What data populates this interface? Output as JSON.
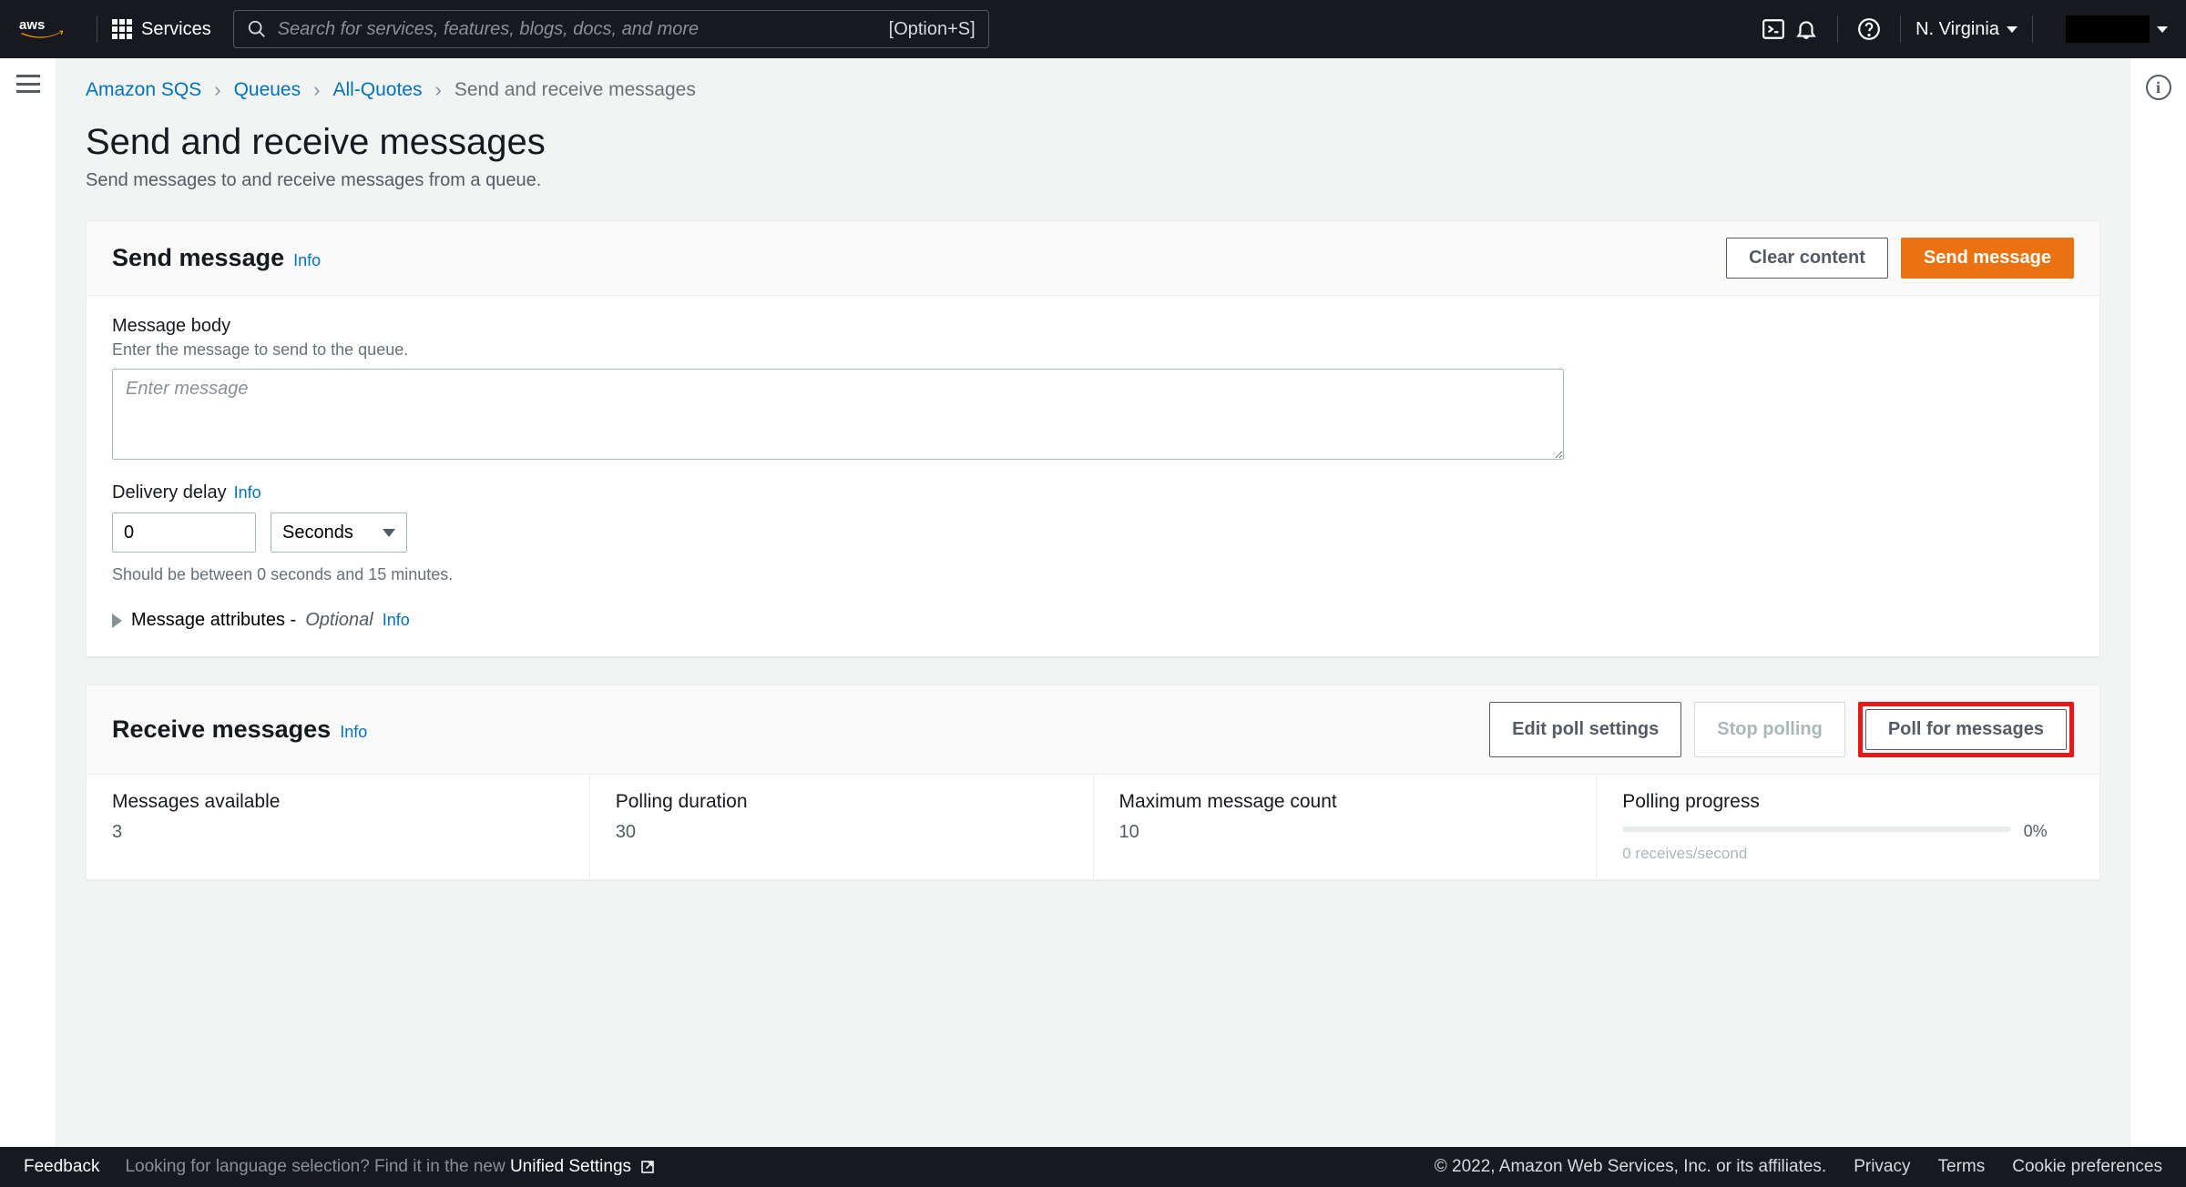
{
  "topnav": {
    "services_label": "Services",
    "search_placeholder": "Search for services, features, blogs, docs, and more",
    "search_hint": "[Option+S]",
    "region": "N. Virginia"
  },
  "breadcrumb": {
    "items": [
      "Amazon SQS",
      "Queues",
      "All-Quotes"
    ],
    "current": "Send and receive messages"
  },
  "page": {
    "title": "Send and receive messages",
    "subtitle": "Send messages to and receive messages from a queue."
  },
  "send_panel": {
    "title": "Send message",
    "info": "Info",
    "clear_btn": "Clear content",
    "send_btn": "Send message",
    "body_label": "Message body",
    "body_desc": "Enter the message to send to the queue.",
    "body_placeholder": "Enter message",
    "delay_label": "Delivery delay",
    "delay_info": "Info",
    "delay_value": "0",
    "delay_unit": "Seconds",
    "delay_hint": "Should be between 0 seconds and 15 minutes.",
    "attrs_label": "Message attributes -",
    "attrs_optional": "Optional",
    "attrs_info": "Info"
  },
  "recv_panel": {
    "title": "Receive messages",
    "info": "Info",
    "edit_btn": "Edit poll settings",
    "stop_btn": "Stop polling",
    "poll_btn": "Poll for messages",
    "stats": {
      "available_label": "Messages available",
      "available_value": "3",
      "duration_label": "Polling duration",
      "duration_value": "30",
      "maxcount_label": "Maximum message count",
      "maxcount_value": "10",
      "progress_label": "Polling progress",
      "progress_pct": "0%",
      "progress_sub": "0 receives/second"
    }
  },
  "footer": {
    "feedback": "Feedback",
    "lang_q": "Looking for language selection? Find it in the new ",
    "lang_link": "Unified Settings",
    "copyright": "© 2022, Amazon Web Services, Inc. or its affiliates.",
    "privacy": "Privacy",
    "terms": "Terms",
    "cookie": "Cookie preferences"
  }
}
